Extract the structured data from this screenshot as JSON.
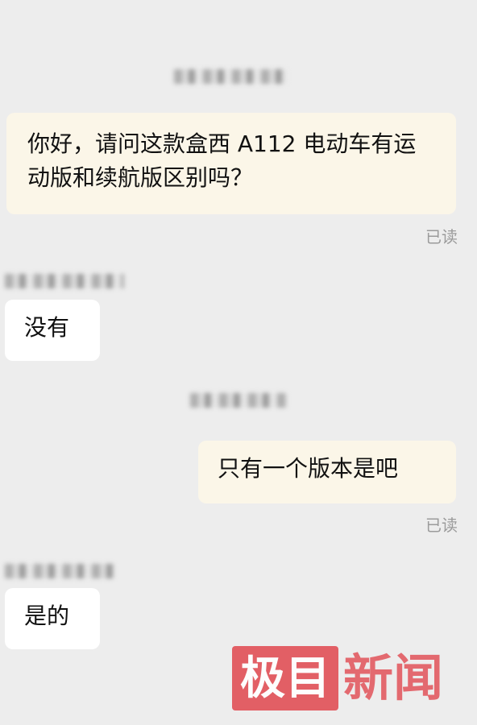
{
  "messages": [
    {
      "side": "right",
      "text": "你好，请问这款盒西 A112 电动车有运动版和续航版区别吗？",
      "status": "已读"
    },
    {
      "side": "left",
      "text": "没有"
    },
    {
      "side": "right",
      "text": "只有一个版本是吧",
      "status": "已读"
    },
    {
      "side": "left",
      "text": "是的"
    }
  ],
  "watermark": {
    "box_text": "极目",
    "text": "新闻"
  }
}
